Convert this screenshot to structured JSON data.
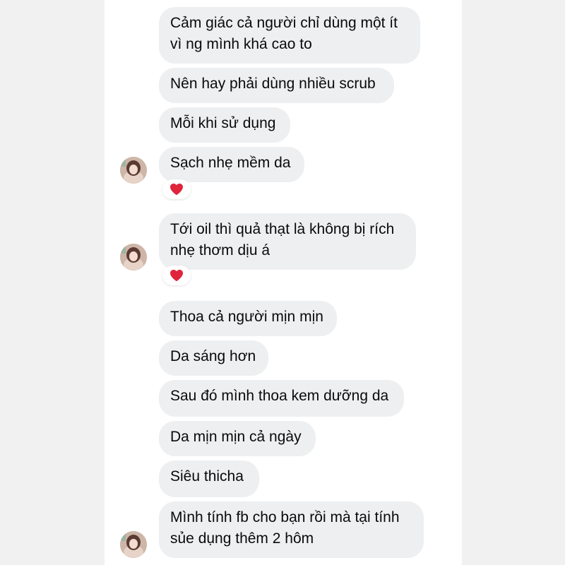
{
  "messages": [
    {
      "text": "Cảm giác cả người chỉ dùng một ít\nvì ng mình khá cao to"
    },
    {
      "text": "Nên hay phải dùng nhiều scrub"
    },
    {
      "text": "Mỗi khi sử dụng"
    },
    {
      "text": "Sạch nhẹ mềm da",
      "reaction": "heart-icon"
    },
    {
      "text": "Tới oil thì quả thạt là không bị rích\nnhẹ thơm dịu á",
      "reaction": "heart-icon"
    },
    {
      "text": "Thoa cả người mịn mịn"
    },
    {
      "text": "Da sáng hơn"
    },
    {
      "text": "Sau đó mình thoa kem dưỡng da"
    },
    {
      "text": "Da mịn mịn cả ngày"
    },
    {
      "text": "Siêu thicha"
    },
    {
      "text": "Mình tính fb cho bạn rồi mà tại tính\nsủe dụng thêm 2 hôm"
    }
  ],
  "colors": {
    "bubble": "#eeeff1",
    "text": "#0a0a0a",
    "heart": "#e0243b"
  }
}
